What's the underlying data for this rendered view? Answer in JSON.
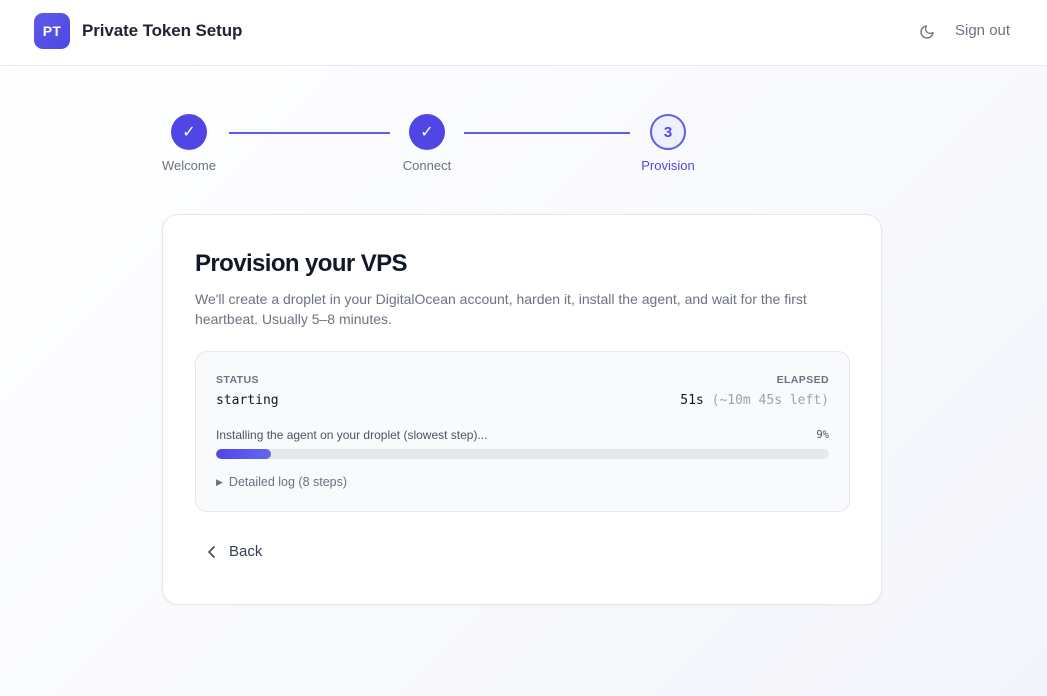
{
  "header": {
    "logo_text": "PT",
    "app_title": "Private Token Setup",
    "theme_icon": "moon-icon",
    "signout_label": "Sign out"
  },
  "stepper": {
    "steps": [
      {
        "label": "Welcome",
        "state": "done",
        "marker": "✓"
      },
      {
        "label": "Connect",
        "state": "done",
        "marker": "✓"
      },
      {
        "label": "Provision",
        "state": "active",
        "marker": "3"
      }
    ]
  },
  "card": {
    "title": "Provision your VPS",
    "description": "We'll create a droplet in your DigitalOcean account, harden it, install the agent, and wait for the first heartbeat. Usually 5–8 minutes.",
    "status": {
      "status_label": "STATUS",
      "status_value": "starting",
      "elapsed_label": "ELAPSED",
      "elapsed_value": "51s",
      "remaining": "(~10m 45s left)",
      "progress_text": "Installing the agent on your droplet (slowest step)...",
      "progress_pct_label": "9%",
      "progress_fraction": 0.09,
      "log_toggle": "Detailed log (8 steps)"
    },
    "back_label": "Back"
  },
  "colors": {
    "accent": "#4f46e5",
    "progress_track": "#e5e7eb",
    "muted_text": "#6b7280"
  }
}
